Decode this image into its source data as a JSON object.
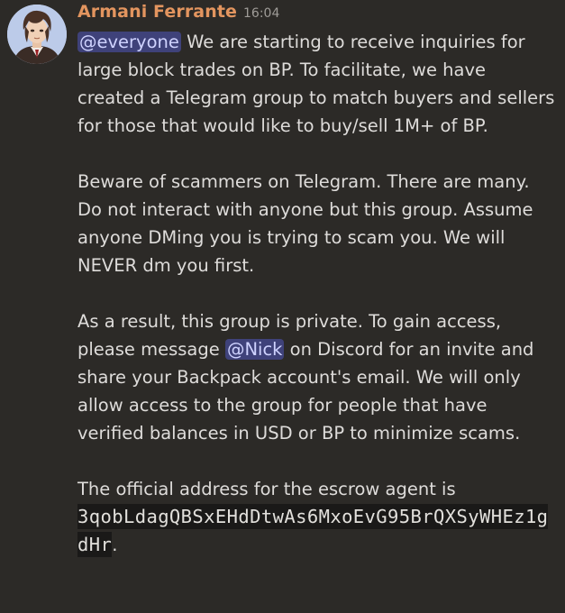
{
  "message": {
    "author": "Armani Ferrante",
    "timestamp": "16:04",
    "author_color": "#e3955f",
    "mention_background": "#3f427a",
    "paragraphs": [
      {
        "mention": "@everyone",
        "text": " We are starting to receive inquiries for large block trades on BP. To facilitate, we have created a Telegram group to match buyers and sellers for those that would like to buy/sell 1M+ of BP."
      },
      {
        "text": "Beware of scammers on Telegram. There are many. Do not interact with anyone but this group. Assume anyone DMing you is trying to scam you. We will NEVER dm you first."
      },
      {
        "text_before": "As a result, this group is private. To gain access, please message ",
        "mention": "@Nick",
        "text_after": "  on Discord for an invite and share your Backpack account's email.  We will only allow access to the group for people that have verified balances in USD or BP to minimize scams."
      },
      {
        "text": "The official address for the escrow agent is ",
        "code": "3qobLdagQBSxEHdDtwAs6MxoEvG95BrQXSyWHEz1gdHr",
        "text_after": "."
      }
    ]
  }
}
